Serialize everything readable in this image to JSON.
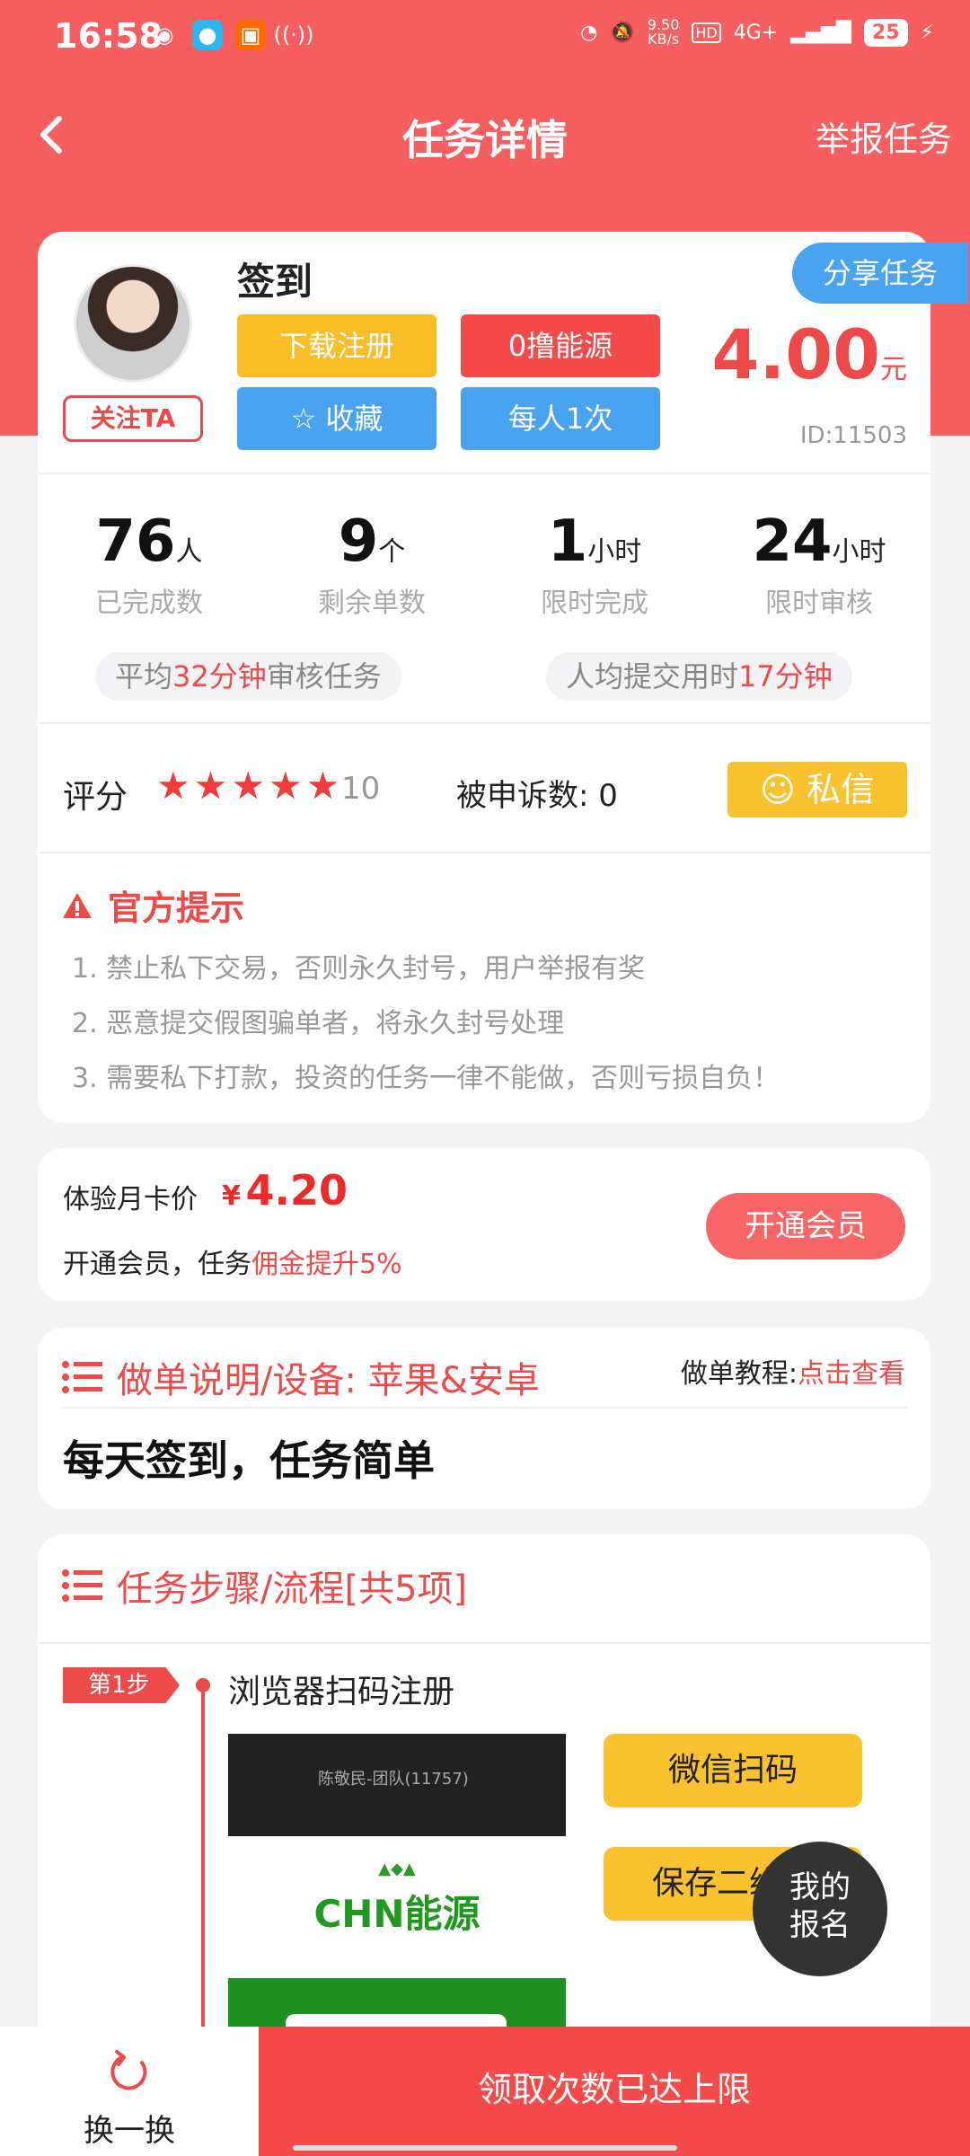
{
  "status_bar": {
    "time": "16:58",
    "speed": "9.50",
    "speed_unit": "KB/s",
    "network": "4G+",
    "battery": "25"
  },
  "nav": {
    "title": "任务详情",
    "report": "举报任务"
  },
  "task": {
    "name": "签到",
    "follow": "关注TA",
    "tags": {
      "download": "下载注册",
      "energy": "0撸能源",
      "collect": "收藏",
      "limit": "每人1次"
    },
    "share": "分享任务",
    "price": "4.00",
    "price_unit": "元",
    "id": "ID:11503"
  },
  "stats": [
    {
      "value": "76",
      "unit": "人",
      "label": "已完成数"
    },
    {
      "value": "9",
      "unit": "个",
      "label": "剩余单数"
    },
    {
      "value": "1",
      "unit": "小时",
      "label": "限时完成"
    },
    {
      "value": "24",
      "unit": "小时",
      "label": "限时审核"
    }
  ],
  "pills": {
    "review_prefix": "平均",
    "review_value": "32分钟",
    "review_suffix": "审核任务",
    "submit_prefix": "人均提交用时",
    "submit_value": "17分钟"
  },
  "rating": {
    "label": "评分",
    "stars": 5,
    "value": "10",
    "appeal": "被申诉数: 0",
    "dm": "私信"
  },
  "tips": {
    "title": "官方提示",
    "items": [
      "1. 禁止私下交易，否则永久封号，用户举报有奖",
      "2. 恶意提交假图骗单者，将永久封号处理",
      "3. 需要私下打款，投资的任务一律不能做，否则亏损自负！"
    ]
  },
  "vip": {
    "label": "体验月卡价",
    "currency": "¥",
    "price": "4.20",
    "sub_prefix": "开通会员，任务",
    "sub_highlight": "佣金提升5%",
    "button": "开通会员"
  },
  "instructions": {
    "title": "做单说明/设备: 苹果&安卓",
    "tutorial_label": "做单教程:",
    "tutorial_link": "点击查看",
    "body": "每天签到，任务简单"
  },
  "steps": {
    "title": "任务步骤/流程[共5项]",
    "step1_badge": "第1步",
    "step1_text": "浏览器扫码注册",
    "screenshot_header": "陈敬民-团队(11757)",
    "screenshot_brand": "CHN能源",
    "wechat_scan": "微信扫码",
    "save_qr": "保存二维码"
  },
  "float": {
    "line1": "我的",
    "line2": "报名"
  },
  "bottom": {
    "refresh": "换一换",
    "claim": "领取次数已达上限"
  },
  "colors": {
    "primary": "#f75e60",
    "accent_red": "#ef4a4a",
    "yellow": "#f9c22e",
    "blue": "#49a3f0"
  }
}
